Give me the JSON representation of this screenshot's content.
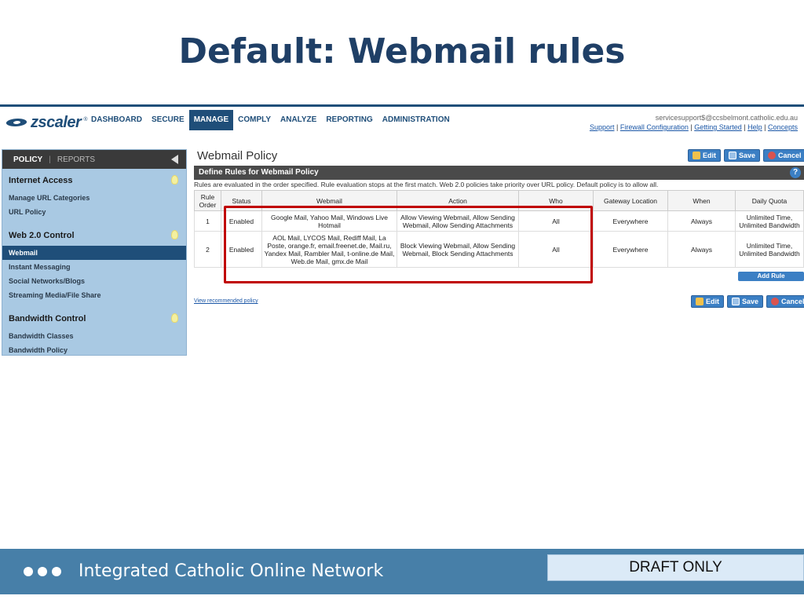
{
  "slide": {
    "title": "Default: Webmail rules"
  },
  "app": {
    "logo": "zscaler",
    "nav": [
      "DASHBOARD",
      "SECURE",
      "MANAGE",
      "COMPLY",
      "ANALYZE",
      "REPORTING",
      "ADMINISTRATION"
    ],
    "active_nav": "MANAGE",
    "user_email": "servicesupport$@ccsbelmont.catholic.edu.au",
    "user_links": [
      "Support",
      "Firewall Configuration",
      "Getting Started",
      "Help",
      "Concepts"
    ]
  },
  "sidebar": {
    "tabs": {
      "policy": "POLICY",
      "sep": "|",
      "reports": "REPORTS"
    },
    "sections": [
      {
        "title": "Internet Access",
        "items": [
          "Manage URL Categories",
          "URL Policy"
        ]
      },
      {
        "title": "Web 2.0 Control",
        "items": [
          "Webmail",
          "Instant Messaging",
          "Social Networks/Blogs",
          "Streaming Media/File Share"
        ]
      },
      {
        "title": "Bandwidth Control",
        "items": [
          "Bandwidth Classes",
          "Bandwidth Policy"
        ]
      }
    ],
    "active_item": "Webmail"
  },
  "content": {
    "title": "Webmail Policy",
    "buttons": {
      "edit": "Edit",
      "save": "Save",
      "cancel": "Cancel"
    },
    "panel_title": "Define Rules for Webmail Policy",
    "help": "?",
    "note": "Rules are evaluated in the order specified. Rule evaluation stops at the first match. Web 2.0 policies take priority over URL policy. Default policy is to allow all.",
    "columns": [
      "Rule Order",
      "Status",
      "Webmail",
      "Action",
      "Who",
      "Gateway Location",
      "When",
      "Daily Quota"
    ],
    "rows": [
      [
        "1",
        "Enabled",
        "Google Mail, Yahoo Mail, Windows Live Hotmail",
        "Allow Viewing Webmail, Allow Sending Webmail, Allow Sending Attachments",
        "All",
        "Everywhere",
        "Always",
        "Unlimited Time, Unlimited Bandwidth"
      ],
      [
        "2",
        "Enabled",
        "AOL Mail, LYCOS Mail, Rediff Mail, La Poste, orange.fr, email.freenet.de, Mail.ru, Yandex Mail, Rambler Mail, t-online.de Mail, Web.de Mail, gmx.de Mail",
        "Block Viewing Webmail, Allow Sending Webmail, Block Sending Attachments",
        "All",
        "Everywhere",
        "Always",
        "Unlimited Time, Unlimited Bandwidth"
      ]
    ],
    "add_rule": "Add Rule",
    "recommended_link": "View recommended policy"
  },
  "footer": {
    "text": "Integrated Catholic Online Network",
    "draft": "DRAFT ONLY"
  },
  "colors": {
    "brand": "#1f4e79",
    "highlight": "#c00000",
    "footer": "#477fa8"
  }
}
